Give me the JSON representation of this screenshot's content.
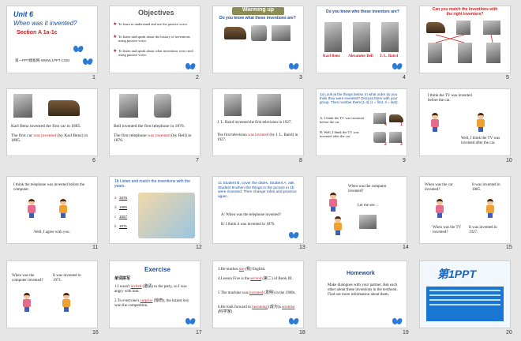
{
  "colors": {
    "accent_blue": "#1a4fa0",
    "accent_red": "#cc1f1f",
    "title_bar_olive": "#8c8c55",
    "butterfly": "#2a7ad6"
  },
  "slides": {
    "s1": {
      "num": "1",
      "unit": "Unit 6",
      "title": "When was it invented?",
      "section": "Section A 1a-1c",
      "footer": "第一PPT模板网-WWW.1PPT.COM"
    },
    "s2": {
      "num": "2",
      "heading": "Objectives",
      "b1": "To learn to understand and use the passive voice.",
      "b2": "To listen and speak about the history of inventions using passive voice.",
      "b3": "To listen and speak about what inventions were used using passive voice."
    },
    "s3": {
      "num": "3",
      "heading": "Warming up",
      "q": "Do you know what these inventions are?"
    },
    "s4": {
      "num": "4",
      "q": "Do you know who these inventors are?",
      "n1": "Karl Benz",
      "n2": "Alexander Bell",
      "n3": "J. L. Baird"
    },
    "s5": {
      "num": "5",
      "q": "Can you match the inventions with the right inventors?"
    },
    "s6": {
      "num": "6",
      "p1": "Karl Benz invented the first car in 1885.",
      "p2a": "The first car ",
      "p2b": "was invented",
      "p2c": " (by Karl Benz) in 1885."
    },
    "s7": {
      "num": "7",
      "p1": "Bell invented the first telephone in 1876.",
      "p2a": "The first telephone ",
      "p2b": "was invented",
      "p2c": " (by Bell) in 1876."
    },
    "s8": {
      "num": "8",
      "p1": "J. L. Baird invented the first television in 1927.",
      "p2a": "The first television ",
      "p2b": "was invented",
      "p2c": " (by J. L. Baird) in 1927."
    },
    "s9": {
      "num": "9",
      "intro": "1a Look at the things below. In what order do you think they were invented? Discuss them with your group. Then number them [1-4] (1 = first, 4 = last).",
      "a": "A: I think the TV was invented before the car.",
      "b": "B: Well, I think the TV was invented after the car.",
      "tag1": "4",
      "tag2": "1",
      "tag3": "2",
      "tag4": "3"
    },
    "s10": {
      "num": "10",
      "a": "I think the TV was invented before the car.",
      "b": "Well, I think the TV was invented after the car."
    },
    "s11": {
      "num": "11",
      "a": "I think the telephone was invented before the computer.",
      "b": "Well, I agree with you."
    },
    "s12": {
      "num": "12",
      "intro": "1b Listen and match the inventions with the years.",
      "y1": "1876",
      "y2": "1885",
      "y3": "1927",
      "y4": "1971",
      "l1": "a",
      "l2": "d",
      "l3": "c",
      "l4": "b"
    },
    "s13": {
      "num": "13",
      "intro": "1c Student B, cover the dates. Student A, ask Student B when the things in the picture in 1b were invented. Then change roles and practice again.",
      "a": "A: When was the telephone invented?",
      "b": "B: I think it was invented in 1876."
    },
    "s14": {
      "num": "14",
      "q": "When was the computer invented?",
      "r": "Let me see…"
    },
    "s15": {
      "num": "15",
      "q1": "When was the car invented?",
      "a1": "It was invented in 1885.",
      "q2": "When was the TV invented?",
      "a2": "It was invented in 1927."
    },
    "s16": {
      "num": "16",
      "q": "When was the computer invented?",
      "a": "It was invented in 1971."
    },
    "s17": {
      "num": "17",
      "heading": "Exercise",
      "sub": "单词拼写",
      "l1a": "1.I wasn't ",
      "l1b": "invited",
      "l1c": " (邀请) to the party, so I was angry with him.",
      "l2a": "2.To everyone's ",
      "l2b": "surprise",
      "l2c": " (惊奇), the laziest boy won the competition."
    },
    "s18": {
      "num": "18",
      "l3a": "3.He teaches ",
      "l3b": "me",
      "l3c": " (我) English.",
      "l4a": "4.Lesson Five is the ",
      "l4b": "second",
      "l4c": " (第二) of Book III.",
      "l5a": "5 The machine was ",
      "l5b": "invented",
      "l5c": " (发明) in the 1980s.",
      "l6a": "6.He look forward to ",
      "l6b": "becoming",
      "l6c": " (成为)a ",
      "l6d": "scientist",
      "l6e": " (科学家)"
    },
    "s19": {
      "num": "19",
      "heading": "Homework",
      "body": "Make dialogues with your partner. Ask each other about these inventions in the textbook. Find out more information about them."
    },
    "s20": {
      "num": "20",
      "logo": "第1PPT"
    }
  }
}
